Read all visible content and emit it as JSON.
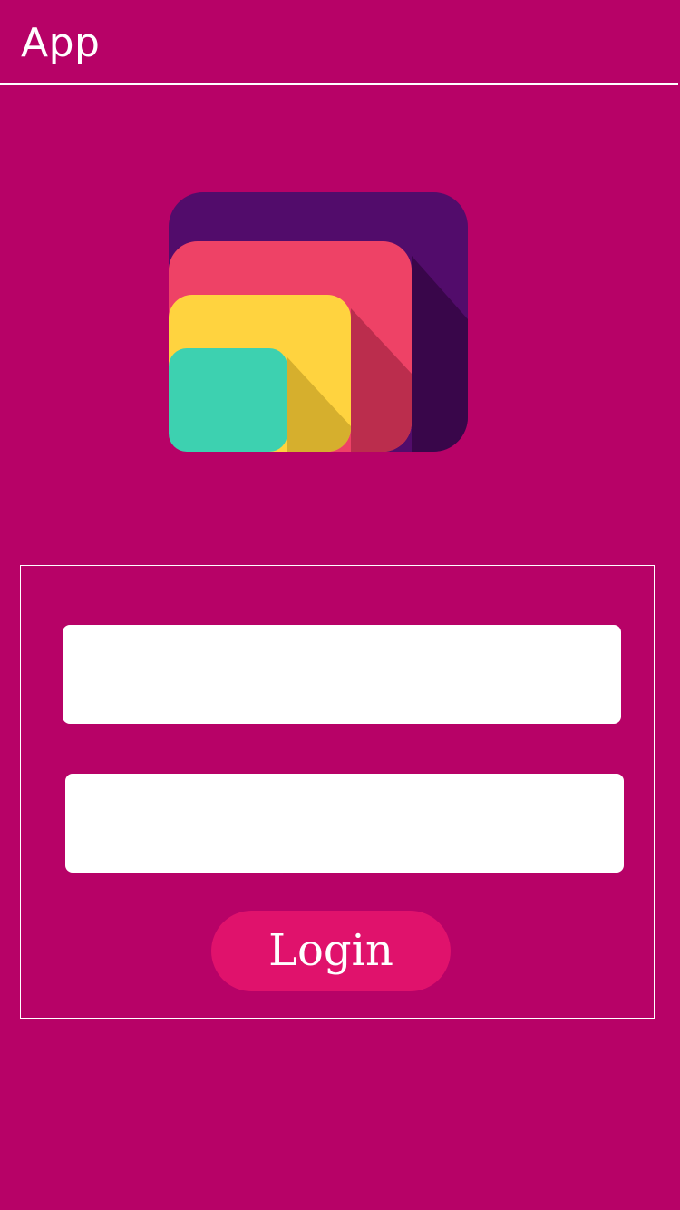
{
  "app": {
    "title": "App"
  },
  "logo": {
    "icon": "layered-squares-logo",
    "colors": {
      "outer": "#520C6B",
      "outer_shadow": "#39064A",
      "second": "#EE4266",
      "second_shadow": "#BB2D4D",
      "third": "#FFD33F",
      "third_shadow": "#D6AF2D",
      "inner": "#3DD1B0"
    }
  },
  "login_form": {
    "field_one": {
      "value": "",
      "placeholder": ""
    },
    "field_two": {
      "value": "",
      "placeholder": ""
    },
    "login_label": "Login"
  },
  "colors": {
    "background": "#B70267",
    "button": "#E0126C",
    "panel_border": "#FFFFFF"
  }
}
